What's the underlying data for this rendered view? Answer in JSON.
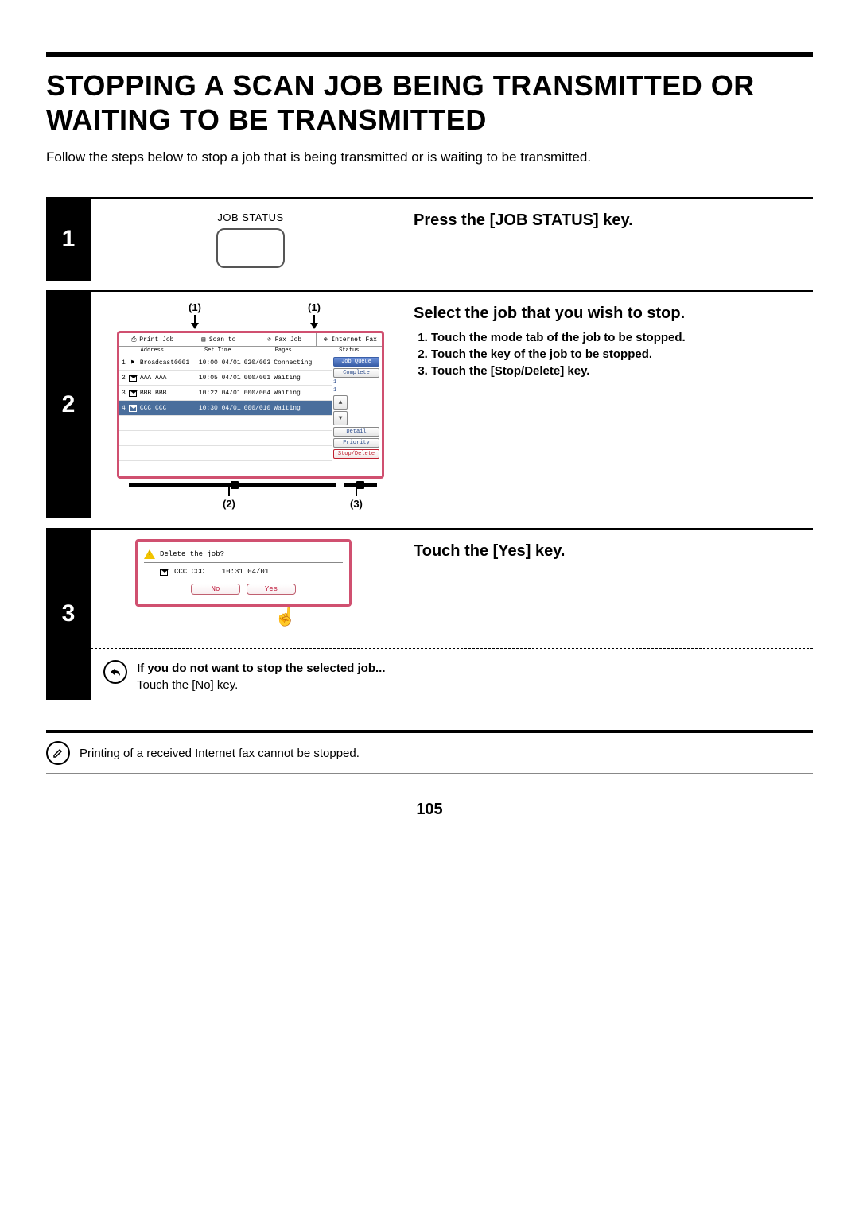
{
  "title": "STOPPING A SCAN JOB BEING TRANSMITTED OR WAITING TO BE TRANSMITTED",
  "intro": "Follow the steps below to stop a job that is being transmitted or is waiting to be transmitted.",
  "page_number": "105",
  "steps": {
    "s1": {
      "num": "1",
      "key_label": "JOB STATUS",
      "heading": "Press the [JOB STATUS] key."
    },
    "s2": {
      "num": "2",
      "heading": "Select the job that you wish to stop.",
      "sub1": "Touch the mode tab of the job to be stopped.",
      "sub2": "Touch the key of the job to be stopped.",
      "sub3": "Touch the [Stop/Delete] key.",
      "callout1": "(1)",
      "callout1b": "(1)",
      "callout2": "(2)",
      "callout3": "(3)",
      "lcd": {
        "tabs": {
          "t1": "Print Job",
          "t2": "Scan to",
          "t3": "Fax Job",
          "t4": "Internet Fax"
        },
        "hdr": {
          "c1": "Address",
          "c2": "Set Time",
          "c3": "Pages",
          "c4": "Status"
        },
        "rows": [
          {
            "n": "1",
            "addr": "Broadcast0001",
            "time": "10:00 04/01",
            "pages": "020/003",
            "status": "Connecting"
          },
          {
            "n": "2",
            "addr": "AAA AAA",
            "time": "10:05 04/01",
            "pages": "000/001",
            "status": "Waiting"
          },
          {
            "n": "3",
            "addr": "BBB BBB",
            "time": "10:22 04/01",
            "pages": "000/004",
            "status": "Waiting"
          },
          {
            "n": "4",
            "addr": "CCC CCC",
            "time": "10:30 04/01",
            "pages": "000/010",
            "status": "Waiting"
          }
        ],
        "side": {
          "job_queue": "Job Queue",
          "complete": "Complete",
          "sets1": "1",
          "sets2": "1",
          "detail": "Detail",
          "priority": "Priority",
          "stop_delete": "Stop/Delete"
        }
      }
    },
    "s3": {
      "num": "3",
      "heading": "Touch the [Yes] key.",
      "dialog": {
        "prompt": "Delete the job?",
        "job_name": "CCC CCC",
        "job_time": "10:31 04/01",
        "no": "No",
        "yes": "Yes"
      },
      "note_head": "If you do not want to stop the selected job...",
      "note_body": "Touch the [No] key."
    }
  },
  "footer_note": "Printing of a received Internet fax cannot be stopped."
}
